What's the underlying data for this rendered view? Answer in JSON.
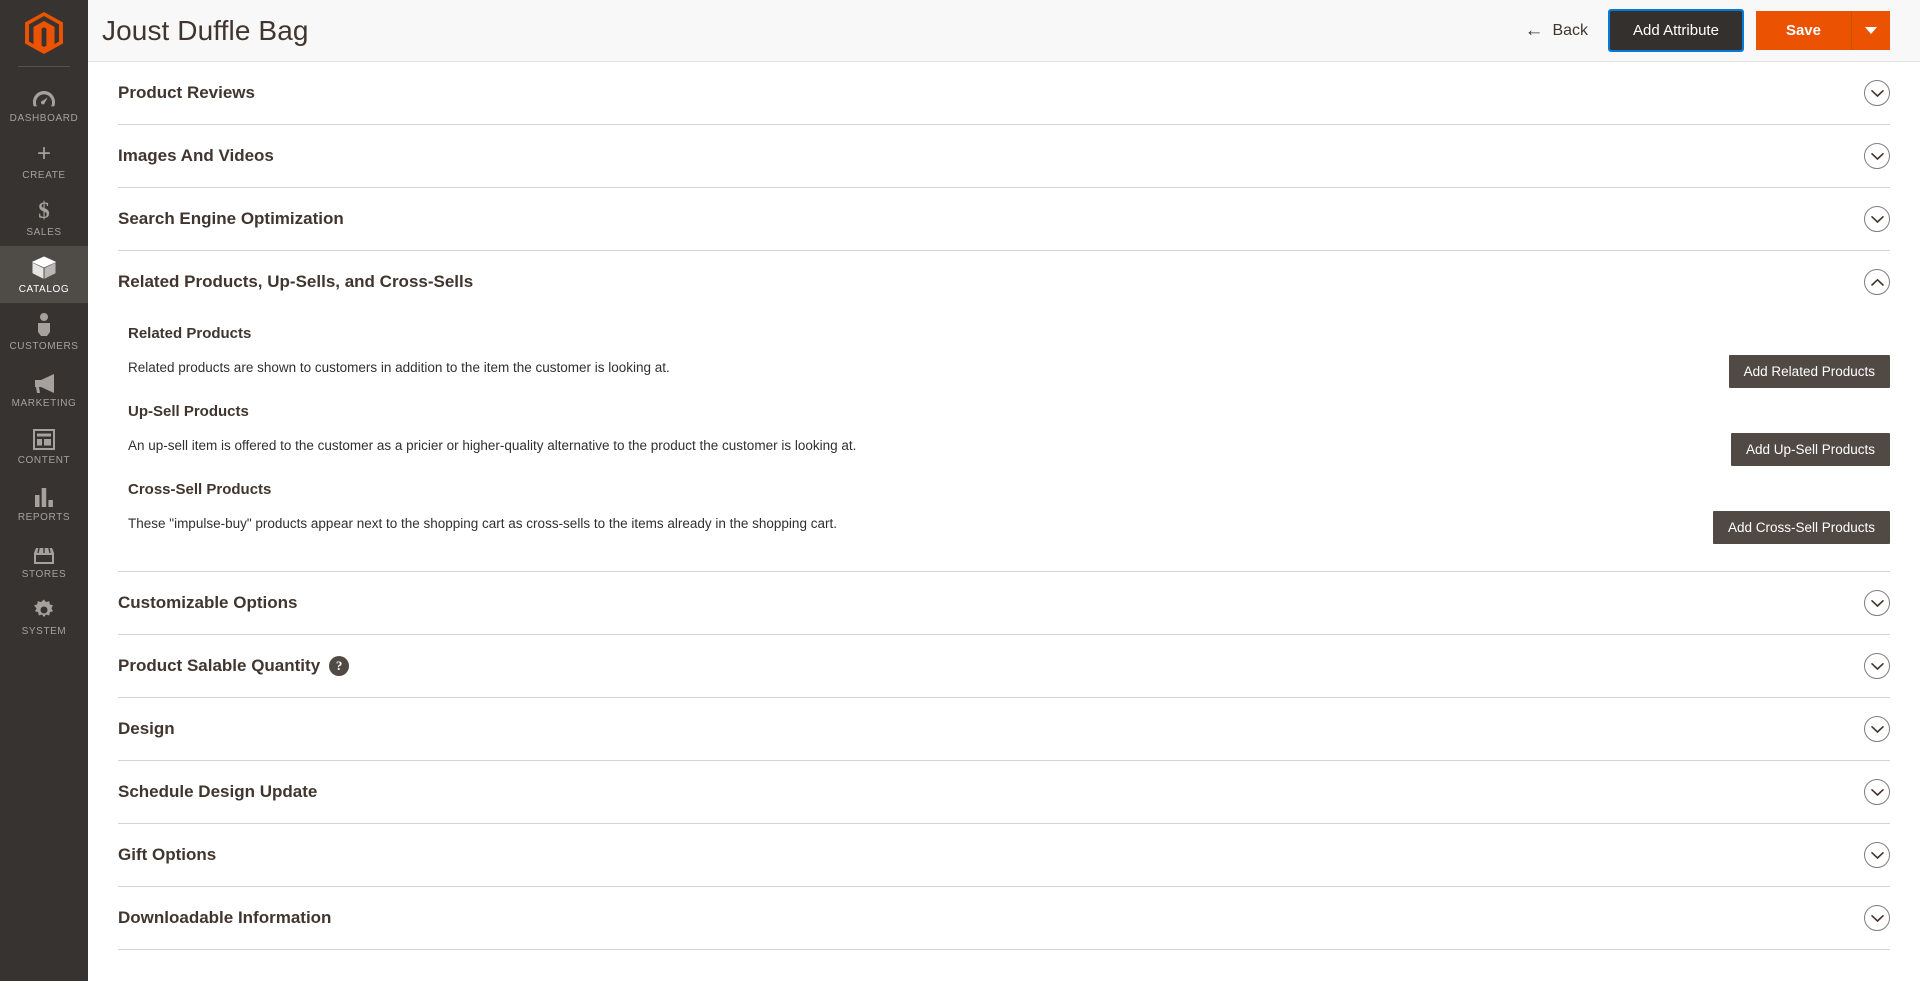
{
  "sidebar": {
    "logo_name": "magento-logo",
    "logo_color": "#eb5202",
    "items": [
      {
        "label": "DASHBOARD",
        "icon": "dashboard-icon",
        "active": false
      },
      {
        "label": "CREATE",
        "icon": "plus-icon",
        "active": false
      },
      {
        "label": "SALES",
        "icon": "dollar-icon",
        "active": false
      },
      {
        "label": "CATALOG",
        "icon": "box-icon",
        "active": true
      },
      {
        "label": "CUSTOMERS",
        "icon": "person-icon",
        "active": false
      },
      {
        "label": "MARKETING",
        "icon": "megaphone-icon",
        "active": false
      },
      {
        "label": "CONTENT",
        "icon": "layout-icon",
        "active": false
      },
      {
        "label": "REPORTS",
        "icon": "bar-chart-icon",
        "active": false
      },
      {
        "label": "STORES",
        "icon": "storefront-icon",
        "active": false
      },
      {
        "label": "SYSTEM",
        "icon": "gear-icon",
        "active": false
      }
    ]
  },
  "header": {
    "title": "Joust Duffle Bag",
    "back_label": "Back",
    "back_icon": "arrow-left-icon",
    "add_attribute_label": "Add Attribute",
    "save_label": "Save",
    "save_toggle_icon": "caret-down-icon",
    "accent_color": "#eb5202",
    "focus_ring_color": "#007bdb"
  },
  "sections": [
    {
      "title": "Product Reviews",
      "expanded": false,
      "chevron": "chevron-down-icon"
    },
    {
      "title": "Images And Videos",
      "expanded": false,
      "chevron": "chevron-down-icon"
    },
    {
      "title": "Search Engine Optimization",
      "expanded": false,
      "chevron": "chevron-down-icon"
    },
    {
      "title": "Related Products, Up-Sells, and Cross-Sells",
      "expanded": true,
      "chevron": "chevron-up-icon"
    },
    {
      "title": "Customizable Options",
      "expanded": false,
      "chevron": "chevron-down-icon"
    },
    {
      "title": "Product Salable Quantity",
      "expanded": false,
      "chevron": "chevron-down-icon",
      "help_icon": "question-mark-icon"
    },
    {
      "title": "Design",
      "expanded": false,
      "chevron": "chevron-down-icon"
    },
    {
      "title": "Schedule Design Update",
      "expanded": false,
      "chevron": "chevron-down-icon"
    },
    {
      "title": "Gift Options",
      "expanded": false,
      "chevron": "chevron-down-icon"
    },
    {
      "title": "Downloadable Information",
      "expanded": false,
      "chevron": "chevron-down-icon"
    }
  ],
  "related_section": {
    "related": {
      "title": "Related Products",
      "description": "Related products are shown to customers in addition to the item the customer is looking at.",
      "button_label": "Add Related Products"
    },
    "upsell": {
      "title": "Up-Sell Products",
      "description": "An up-sell item is offered to the customer as a pricier or higher-quality alternative to the product the customer is looking at.",
      "button_label": "Add Up-Sell Products"
    },
    "crosssell": {
      "title": "Cross-Sell Products",
      "description": "These \"impulse-buy\" products appear next to the shopping cart as cross-sells to the items already in the shopping cart.",
      "button_label": "Add Cross-Sell Products"
    }
  }
}
